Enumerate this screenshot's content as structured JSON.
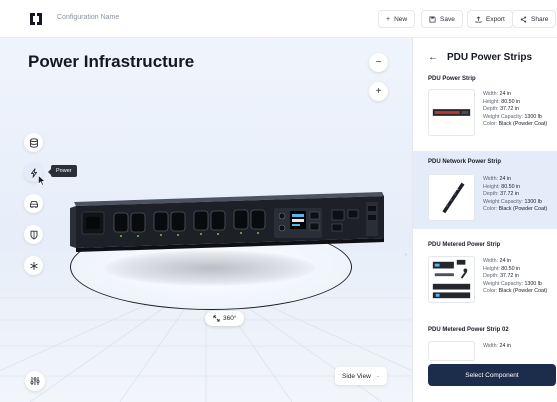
{
  "header": {
    "config_name": "Configuration Name",
    "new_label": "New",
    "save_label": "Save",
    "export_label": "Export",
    "share_label": "Share"
  },
  "viewport": {
    "title": "Power Infrastructure",
    "zoom_out_symbol": "−",
    "zoom_in_symbol": "+",
    "tooltip": "Power",
    "rotate_label": "360°",
    "view_select": "Side View",
    "side_tools": [
      "database-icon",
      "power-icon",
      "car-icon",
      "shield-icon",
      "snowflake-icon"
    ]
  },
  "panel": {
    "title": "PDU Power Strips",
    "spec_labels": {
      "width": "Width:",
      "height": "Height:",
      "depth": "Depth:",
      "weight": "Weight Capacity:",
      "color": "Color:"
    },
    "items": [
      {
        "name": "PDU Power Strip",
        "width": "24 in",
        "height": "80.50 in",
        "depth": "37.72 in",
        "weight": "1300 lb",
        "color": "Black (Powder Coat)"
      },
      {
        "name": "PDU Network Power Strip",
        "width": "24 in",
        "height": "80.50 in",
        "depth": "37.72 in",
        "weight": "1300 lb",
        "color": "Black (Powder Coat)"
      },
      {
        "name": "PDU Metered Power Strip",
        "width": "24 in",
        "height": "80.50 in",
        "depth": "37.72 in",
        "weight": "1300 lb",
        "color": "Black (Powder Coat)"
      },
      {
        "name": "PDU Metered Power Strip 02",
        "width": "24 in"
      }
    ],
    "select_label": "Select Component"
  },
  "colors": {
    "accent": "#1c2c4b",
    "selected_card": "#e3ecf8",
    "viewport_bg": "#eaf1fb"
  }
}
